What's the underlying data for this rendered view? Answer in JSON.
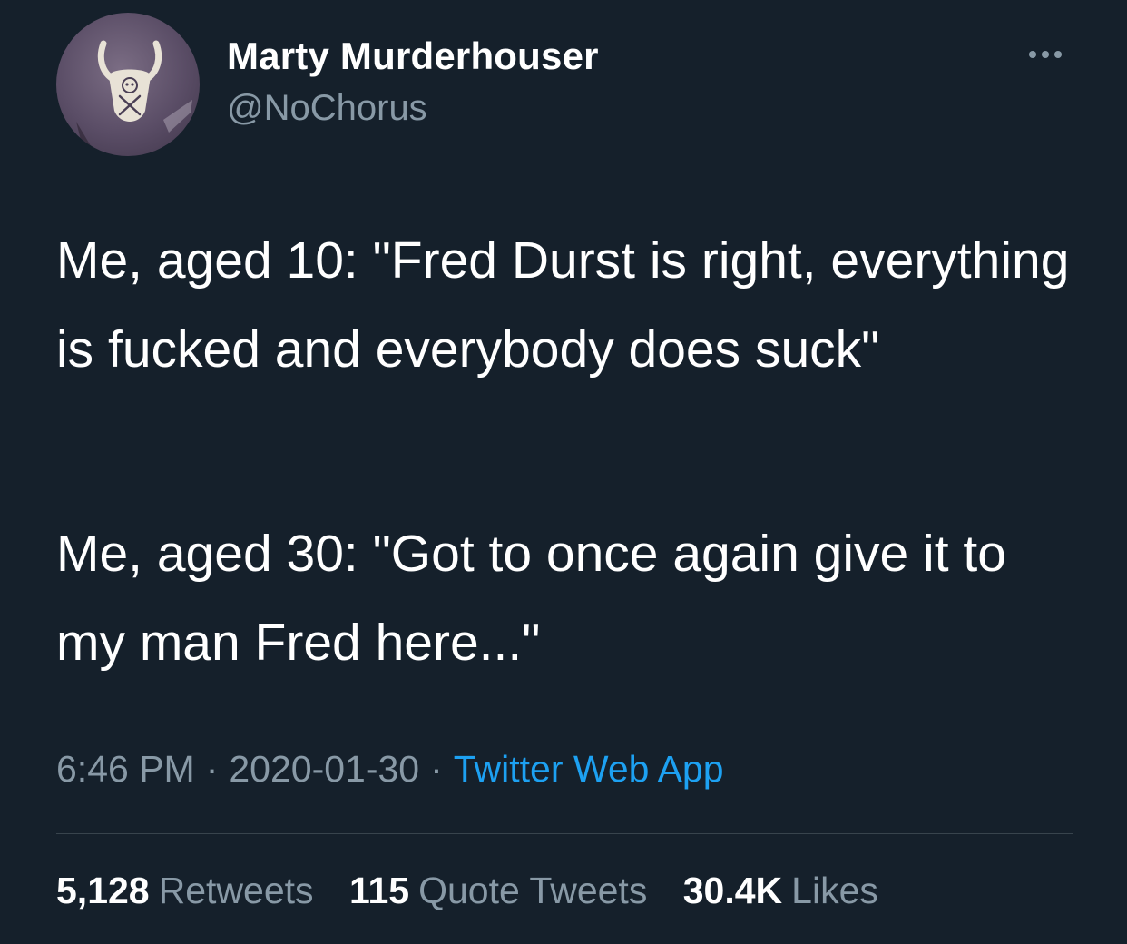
{
  "colors": {
    "background": "#15202b",
    "text_primary": "#ffffff",
    "text_secondary": "#8899a6",
    "link": "#1da1f2",
    "divider": "#38444d"
  },
  "author": {
    "display_name": "Marty Murderhouser",
    "handle": "@NoChorus",
    "avatar_icon": "horned-skull-avatar"
  },
  "more_icon": "more-horizontal-icon",
  "tweet": {
    "paragraphs": [
      "Me, aged 10: \"Fred Durst is right, everything is fucked and everybody does suck\"",
      "Me, aged 30: \"Got to once again give it to my man Fred here...\""
    ]
  },
  "meta": {
    "time": "6:46 PM",
    "separator": "·",
    "date": "2020-01-30",
    "source": "Twitter Web App"
  },
  "stats": {
    "retweets": {
      "count": "5,128",
      "label": "Retweets"
    },
    "quotes": {
      "count": "115",
      "label": "Quote Tweets"
    },
    "likes": {
      "count": "30.4K",
      "label": "Likes"
    }
  }
}
